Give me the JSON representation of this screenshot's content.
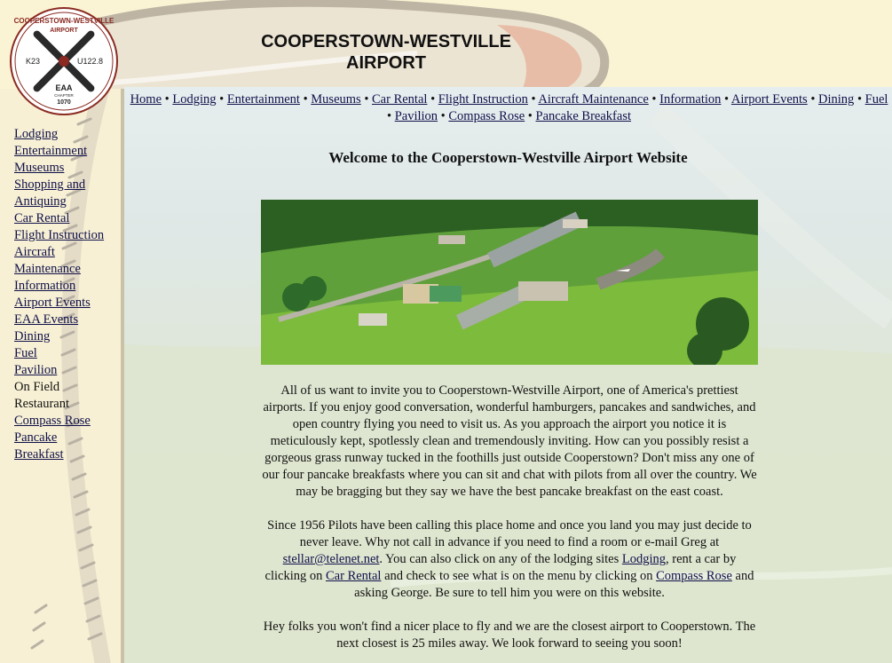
{
  "site": {
    "title_line1": "COOPERSTOWN-WESTVILLE",
    "title_line2": "AIRPORT"
  },
  "logo": {
    "top_text": "COOPERSTOWN-WESTVILLE",
    "top_text2": "AIRPORT",
    "left_code": "K23",
    "right_code": "U122.8",
    "bottom_text": "EAA",
    "bottom_text2": "CHAPTER",
    "bottom_text3": "1070"
  },
  "top_nav": {
    "items": [
      "Home",
      "Lodging",
      "Entertainment",
      "Museums",
      "Car Rental",
      "Flight Instruction",
      "Aircraft Maintenance",
      "Information",
      "Airport Events",
      "Dining",
      "Fuel",
      "Pavilion",
      "Compass Rose",
      "Pancake Breakfast"
    ],
    "separator": "•"
  },
  "sidebar": {
    "items": [
      {
        "label": "Lodging",
        "link": true
      },
      {
        "label": "Entertainment",
        "link": true
      },
      {
        "label": "Museums",
        "link": true
      },
      {
        "label": "Shopping and",
        "link": true
      },
      {
        "label": "Antiquing",
        "link": true
      },
      {
        "label": "Car Rental",
        "link": true
      },
      {
        "label": "Flight Instruction",
        "link": true
      },
      {
        "label": "Aircraft",
        "link": true
      },
      {
        "label": "Maintenance",
        "link": true
      },
      {
        "label": "Information",
        "link": true
      },
      {
        "label": "Airport Events",
        "link": true
      },
      {
        "label": "EAA Events",
        "link": true
      },
      {
        "label": "Dining",
        "link": true
      },
      {
        "label": "Fuel",
        "link": true
      },
      {
        "label": "Pavilion",
        "link": true
      },
      {
        "label": "On Field",
        "link": false
      },
      {
        "label": "Restaurant",
        "link": false
      },
      {
        "label": "Compass Rose",
        "link": true
      },
      {
        "label": "Pancake",
        "link": true
      },
      {
        "label": "Breakfast",
        "link": true
      }
    ]
  },
  "main": {
    "welcome": "Welcome to the Cooperstown-Westville Airport Website",
    "para1": "All of us want to invite you to Cooperstown-Westville Airport, one of America's prettiest airports. If you enjoy good conversation, wonderful hamburgers, pancakes and sandwiches, and open country flying you need to visit us. As you approach the airport you notice it is meticulously kept, spotlessly clean and tremendously inviting. How can you possibly resist a gorgeous grass runway tucked in the foothills just outside Cooperstown? Don't miss any one of our four pancake breakfasts where you can sit and chat with pilots from all over the country. We may be bragging but they say we have the best pancake breakfast on the east coast.",
    "para2_a": "Since 1956 Pilots have been calling this place home and once you land you may just decide to never leave. Why not call in advance if you need to find a room or e-mail Greg at ",
    "para2_email": "stellar@telenet.net",
    "para2_b": ". You can also click on any of the lodging sites ",
    "para2_lodging": "Lodging",
    "para2_c": ", rent a car by clicking on ",
    "para2_car": "Car Rental",
    "para2_d": " and check to see what is on the menu by clicking on ",
    "para2_compass": "Compass Rose",
    "para2_e": " and asking George. Be sure to tell him you were on this website.",
    "para3": "Hey folks you won't find a nicer place to fly and we are the closest airport to Cooperstown. The next closest is 25 miles away. We look forward to seeing you soon!"
  },
  "colors": {
    "link": "#10104a",
    "header_bg": "#fbf4d4",
    "sidebar_bg": "#f7f0d4",
    "propeller": "#cfc6b6",
    "stitch": "#b9b2a4"
  }
}
